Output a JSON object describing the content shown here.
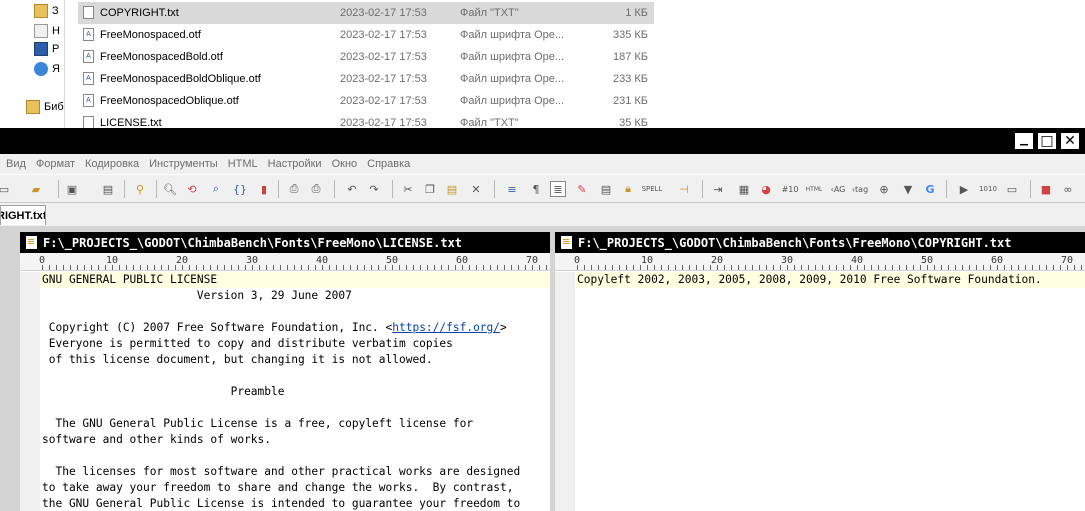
{
  "explorer": {
    "nav": [
      {
        "label": "З",
        "icon": "folder-user-icon"
      },
      {
        "label": "Н",
        "icon": "folder-icon"
      },
      {
        "label": "Р",
        "icon": "desktop-icon"
      },
      {
        "label": "Я",
        "icon": "cloud-icon"
      },
      {
        "label": "Биб",
        "icon": "library-icon"
      }
    ],
    "files": [
      {
        "name": "COPYRIGHT.txt",
        "date": "2023-02-17 17:53",
        "type": "Файл \"TXT\"",
        "size": "1 КБ",
        "selected": true
      },
      {
        "name": "FreeMonospaced.otf",
        "date": "2023-02-17 17:53",
        "type": "Файл шрифта Ope...",
        "size": "335 КБ"
      },
      {
        "name": "FreeMonospacedBold.otf",
        "date": "2023-02-17 17:53",
        "type": "Файл шрифта Ope...",
        "size": "187 КБ"
      },
      {
        "name": "FreeMonospacedBoldOblique.otf",
        "date": "2023-02-17 17:53",
        "type": "Файл шрифта Ope...",
        "size": "233 КБ"
      },
      {
        "name": "FreeMonospacedOblique.otf",
        "date": "2023-02-17 17:53",
        "type": "Файл шрифта Ope...",
        "size": "231 КБ"
      },
      {
        "name": "LICENSE.txt",
        "date": "2023-02-17 17:53",
        "type": "Файл \"TXT\"",
        "size": "35 КБ"
      }
    ]
  },
  "window": {
    "minimize": "▁",
    "maximize": "□",
    "close": "✕"
  },
  "menu": [
    "Вид",
    "Формат",
    "Кодировка",
    "Инструменты",
    "HTML",
    "Настройки",
    "Окно",
    "Справка"
  ],
  "tabs": {
    "active": "RIGHT.txt"
  },
  "panes": {
    "left": {
      "path": "F:\\_PROJECTS_\\GODOT\\ChimbaBench\\Fonts\\FreeMono\\LICENSE.txt",
      "ruler": [
        "0",
        "10",
        "20",
        "30",
        "40",
        "50",
        "60",
        "70"
      ],
      "lines": [
        "GNU GENERAL PUBLIC LICENSE",
        "                       Version 3, 29 June 2007",
        "",
        " Copyright (C) 2007 Free Software Foundation, Inc. <",
        " Everyone is permitted to copy and distribute verbatim copies",
        " of this license document, but changing it is not allowed.",
        "",
        "                            Preamble",
        "",
        "  The GNU General Public License is a free, copyleft license for",
        "software and other kinds of works.",
        "",
        "  The licenses for most software and other practical works are designed",
        "to take away your freedom to share and change the works.  By contrast,",
        "the GNU General Public License is intended to guarantee your freedom to"
      ],
      "link": "https://fsf.org/",
      "link_suffix": ">"
    },
    "right": {
      "path": "F:\\_PROJECTS_\\GODOT\\ChimbaBench\\Fonts\\FreeMono\\COPYRIGHT.txt",
      "ruler": [
        "0",
        "10",
        "20",
        "30",
        "40",
        "50",
        "60",
        "70"
      ],
      "lines": [
        "Copyleft 2002, 2003, 2005, 2008, 2009, 2010 Free Software Foundation."
      ]
    }
  }
}
